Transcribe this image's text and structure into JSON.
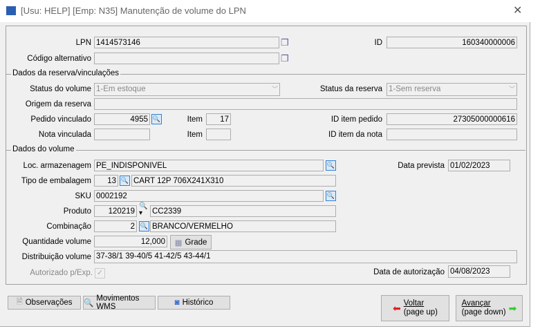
{
  "window": {
    "title": "[Usu: HELP] [Emp: N35] Manutenção de volume do LPN",
    "close": "✕"
  },
  "top": {
    "lpn_label": "LPN",
    "lpn": "1414573146",
    "alt_label": "Código alternativo",
    "alt": "",
    "id_label": "ID",
    "id": "160340000006"
  },
  "reserva": {
    "legend": "Dados da reserva/vinculações",
    "status_volume_label": "Status do volume",
    "status_volume": "1-Em estoque",
    "status_reserva_label": "Status da reserva",
    "status_reserva": "1-Sem reserva",
    "origem_label": "Origem da reserva",
    "origem": "",
    "pedido_label": "Pedido vinculado",
    "pedido": "4955",
    "item_label": "Item",
    "item": "17",
    "id_item_pedido_label": "ID item pedido",
    "id_item_pedido": "27305000000616",
    "nota_label": "Nota vinculada",
    "nota": "",
    "item2_label": "Item",
    "item2": "",
    "id_item_nota_label": "ID item da nota",
    "id_item_nota": ""
  },
  "volume": {
    "legend": "Dados do volume",
    "loc_label": "Loc. armazenagem",
    "loc": "PE_INDISPONIVEL",
    "data_prevista_label": "Data prevista",
    "data_prevista": "01/02/2023",
    "tipo_label": "Tipo de embalagem",
    "tipo_code": "13",
    "tipo_desc": "CART 12P 706X241X310",
    "sku_label": "SKU",
    "sku": "0002192",
    "produto_label": "Produto",
    "produto_code": "120219",
    "produto_desc": "CC2339",
    "comb_label": "Combinação",
    "comb_code": "2",
    "comb_desc": "BRANCO/VERMELHO",
    "qtd_label": "Quantidade volume",
    "qtd": "12,000",
    "grade_button": "Grade",
    "dist_label": "Distribuição volume",
    "dist": "37-38/1 39-40/5 41-42/5 43-44/1",
    "autorizado_label": "Autorizado p/Exp.",
    "autorizado_checked": true,
    "data_aut_label": "Data de autorização",
    "data_aut": "04/08/2023"
  },
  "buttons": {
    "obs": "Observações",
    "mov": "Movimentos WMS",
    "hist": "Histórico",
    "voltar": "Voltar",
    "voltar_sub": "(page up)",
    "avancar": "Avançar",
    "avancar_sub": "(page down)"
  }
}
